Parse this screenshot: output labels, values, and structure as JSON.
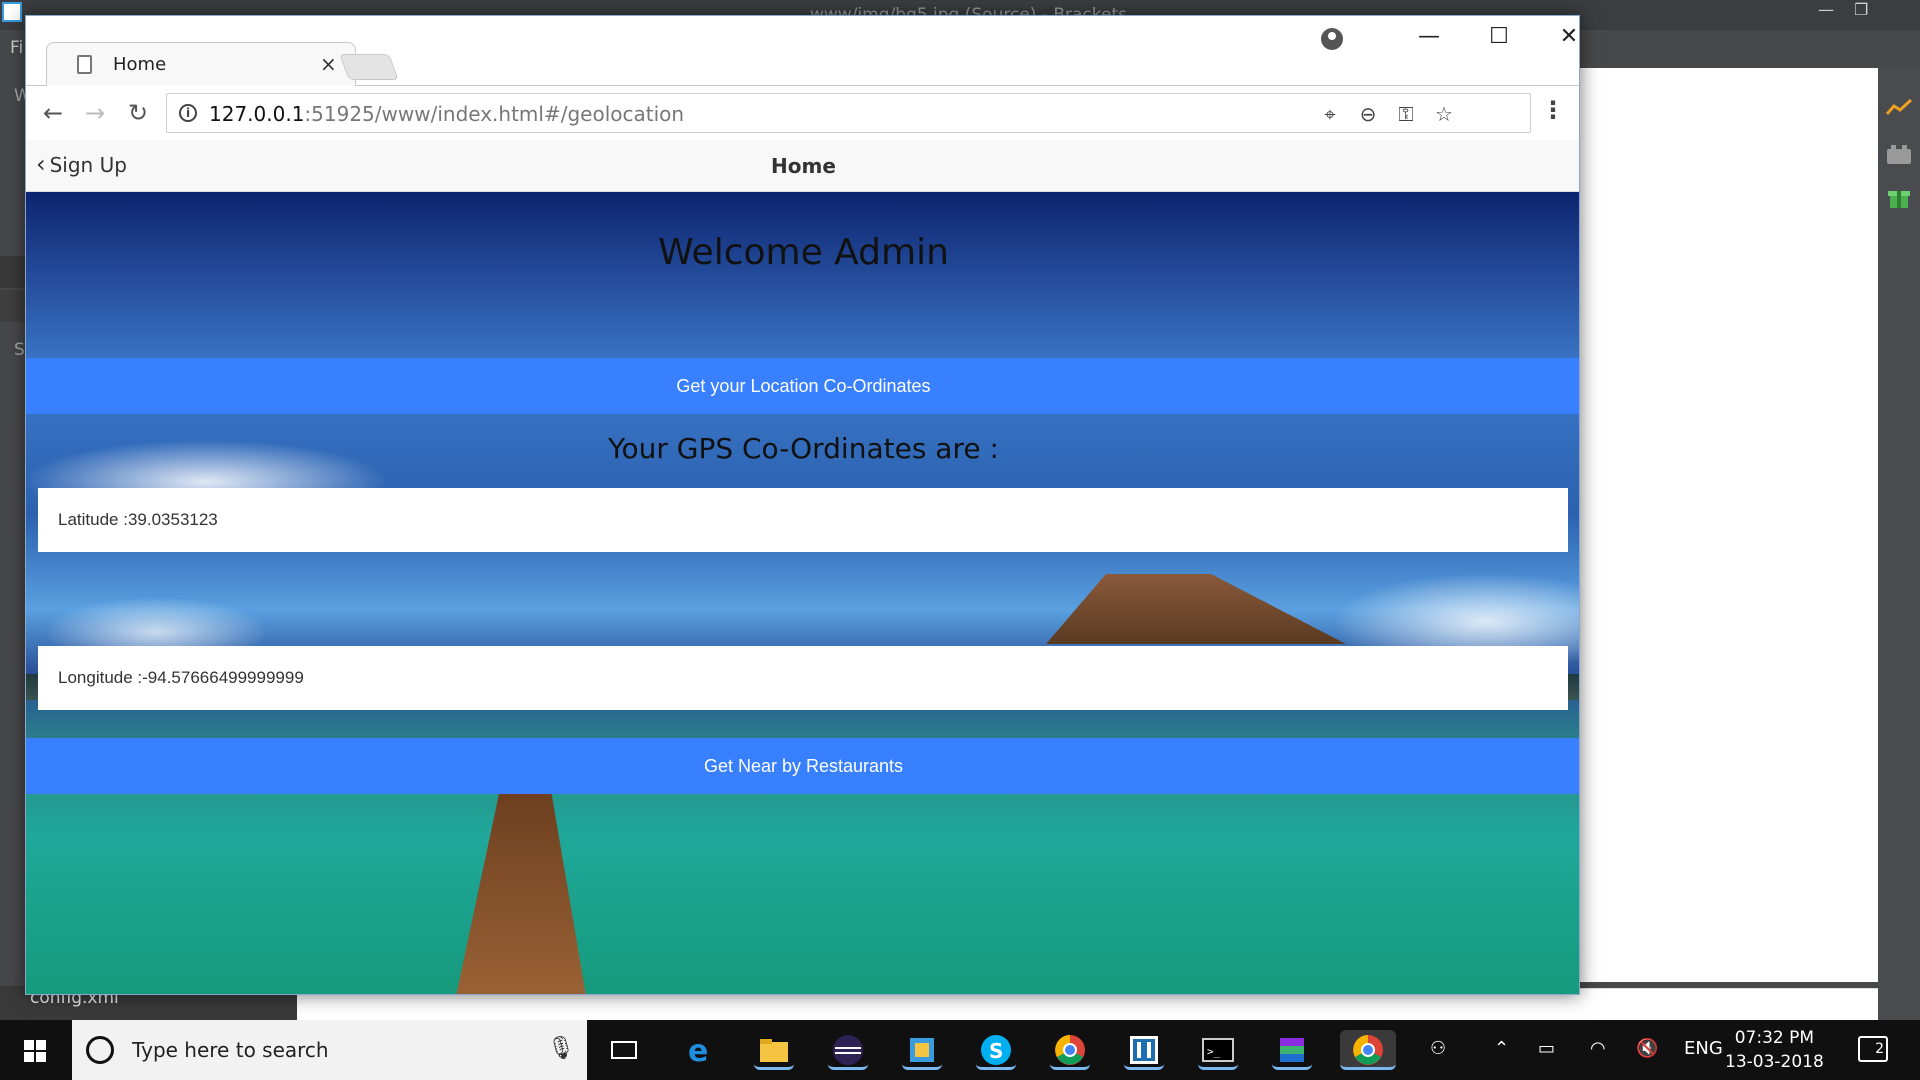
{
  "brackets": {
    "title": "www/img/bg5.jpg (Source) - Brackets",
    "menu_letter": "Fi",
    "sidebar_letter_w": "W",
    "sidebar_letter_s": "S",
    "open_file": "config.xml"
  },
  "chrome": {
    "tab_title": "Home",
    "tab_close": "×",
    "url_host": "127.0.0.1",
    "url_rest": ":51925/www/index.html#/geolocation",
    "window_controls": {
      "minimize": "—",
      "maximize": "☐",
      "close": "✕"
    }
  },
  "app": {
    "back_label": "Sign Up",
    "header_title": "Home",
    "welcome": "Welcome Admin",
    "get_coords_button": "Get your Location Co-Ordinates",
    "gps_title": "Your GPS Co-Ordinates are :",
    "latitude": "Latitude :39.0353123",
    "longitude": "Longitude :-94.57666499999999",
    "restaurants_button": "Get Near by Restaurants"
  },
  "taskbar": {
    "search_placeholder": "Type here to search",
    "language": "ENG",
    "time": "07:32 PM",
    "date": "13-03-2018",
    "notification_count": "2"
  },
  "colors": {
    "button_blue": "#3880ff",
    "taskbar": "#101010",
    "brackets_bg": "#47484b"
  }
}
